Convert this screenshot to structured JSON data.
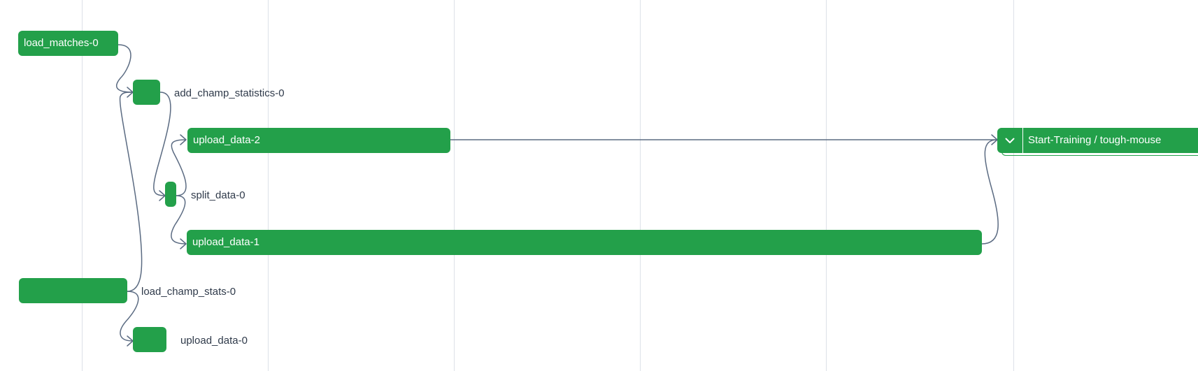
{
  "colors": {
    "success": "#23a04a",
    "edge": "#5b6b82",
    "grid": "#dde1e8",
    "label_outside": "#2f3a4a"
  },
  "graph": {
    "nodes": [
      {
        "id": "load_matches-0",
        "label": "load_matches-0",
        "state": "success"
      },
      {
        "id": "add_champ_statistics-0",
        "label": "add_champ_statistics-0",
        "state": "success"
      },
      {
        "id": "upload_data-2",
        "label": "upload_data-2",
        "state": "success"
      },
      {
        "id": "split_data-0",
        "label": "split_data-0",
        "state": "success"
      },
      {
        "id": "upload_data-1",
        "label": "upload_data-1",
        "state": "success"
      },
      {
        "id": "load_champ_stats-0",
        "label": "load_champ_stats-0",
        "state": "success"
      },
      {
        "id": "upload_data-0",
        "label": "upload_data-0",
        "state": "success"
      }
    ],
    "group": {
      "label": "Start-Training / tough-mouse",
      "toggle_icon": "chevron-down-icon",
      "state": "success"
    }
  }
}
